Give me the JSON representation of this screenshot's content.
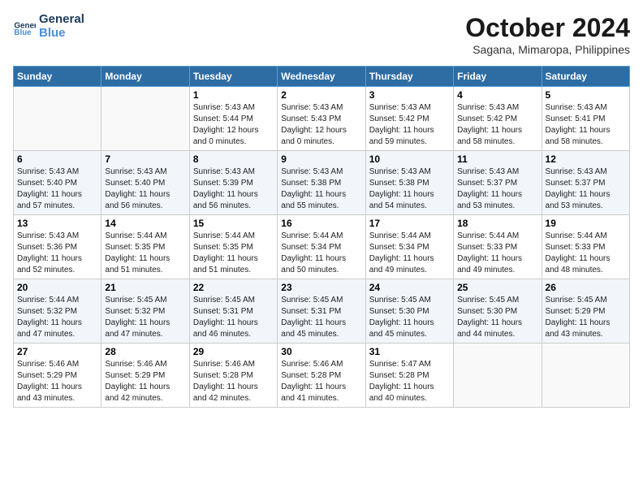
{
  "logo": {
    "line1": "General",
    "line2": "Blue"
  },
  "title": "October 2024",
  "subtitle": "Sagana, Mimaropa, Philippines",
  "weekdays": [
    "Sunday",
    "Monday",
    "Tuesday",
    "Wednesday",
    "Thursday",
    "Friday",
    "Saturday"
  ],
  "weeks": [
    [
      {
        "day": "",
        "info": ""
      },
      {
        "day": "",
        "info": ""
      },
      {
        "day": "1",
        "info": "Sunrise: 5:43 AM\nSunset: 5:44 PM\nDaylight: 12 hours\nand 0 minutes."
      },
      {
        "day": "2",
        "info": "Sunrise: 5:43 AM\nSunset: 5:43 PM\nDaylight: 12 hours\nand 0 minutes."
      },
      {
        "day": "3",
        "info": "Sunrise: 5:43 AM\nSunset: 5:42 PM\nDaylight: 11 hours\nand 59 minutes."
      },
      {
        "day": "4",
        "info": "Sunrise: 5:43 AM\nSunset: 5:42 PM\nDaylight: 11 hours\nand 58 minutes."
      },
      {
        "day": "5",
        "info": "Sunrise: 5:43 AM\nSunset: 5:41 PM\nDaylight: 11 hours\nand 58 minutes."
      }
    ],
    [
      {
        "day": "6",
        "info": "Sunrise: 5:43 AM\nSunset: 5:40 PM\nDaylight: 11 hours\nand 57 minutes."
      },
      {
        "day": "7",
        "info": "Sunrise: 5:43 AM\nSunset: 5:40 PM\nDaylight: 11 hours\nand 56 minutes."
      },
      {
        "day": "8",
        "info": "Sunrise: 5:43 AM\nSunset: 5:39 PM\nDaylight: 11 hours\nand 56 minutes."
      },
      {
        "day": "9",
        "info": "Sunrise: 5:43 AM\nSunset: 5:38 PM\nDaylight: 11 hours\nand 55 minutes."
      },
      {
        "day": "10",
        "info": "Sunrise: 5:43 AM\nSunset: 5:38 PM\nDaylight: 11 hours\nand 54 minutes."
      },
      {
        "day": "11",
        "info": "Sunrise: 5:43 AM\nSunset: 5:37 PM\nDaylight: 11 hours\nand 53 minutes."
      },
      {
        "day": "12",
        "info": "Sunrise: 5:43 AM\nSunset: 5:37 PM\nDaylight: 11 hours\nand 53 minutes."
      }
    ],
    [
      {
        "day": "13",
        "info": "Sunrise: 5:43 AM\nSunset: 5:36 PM\nDaylight: 11 hours\nand 52 minutes."
      },
      {
        "day": "14",
        "info": "Sunrise: 5:44 AM\nSunset: 5:35 PM\nDaylight: 11 hours\nand 51 minutes."
      },
      {
        "day": "15",
        "info": "Sunrise: 5:44 AM\nSunset: 5:35 PM\nDaylight: 11 hours\nand 51 minutes."
      },
      {
        "day": "16",
        "info": "Sunrise: 5:44 AM\nSunset: 5:34 PM\nDaylight: 11 hours\nand 50 minutes."
      },
      {
        "day": "17",
        "info": "Sunrise: 5:44 AM\nSunset: 5:34 PM\nDaylight: 11 hours\nand 49 minutes."
      },
      {
        "day": "18",
        "info": "Sunrise: 5:44 AM\nSunset: 5:33 PM\nDaylight: 11 hours\nand 49 minutes."
      },
      {
        "day": "19",
        "info": "Sunrise: 5:44 AM\nSunset: 5:33 PM\nDaylight: 11 hours\nand 48 minutes."
      }
    ],
    [
      {
        "day": "20",
        "info": "Sunrise: 5:44 AM\nSunset: 5:32 PM\nDaylight: 11 hours\nand 47 minutes."
      },
      {
        "day": "21",
        "info": "Sunrise: 5:45 AM\nSunset: 5:32 PM\nDaylight: 11 hours\nand 47 minutes."
      },
      {
        "day": "22",
        "info": "Sunrise: 5:45 AM\nSunset: 5:31 PM\nDaylight: 11 hours\nand 46 minutes."
      },
      {
        "day": "23",
        "info": "Sunrise: 5:45 AM\nSunset: 5:31 PM\nDaylight: 11 hours\nand 45 minutes."
      },
      {
        "day": "24",
        "info": "Sunrise: 5:45 AM\nSunset: 5:30 PM\nDaylight: 11 hours\nand 45 minutes."
      },
      {
        "day": "25",
        "info": "Sunrise: 5:45 AM\nSunset: 5:30 PM\nDaylight: 11 hours\nand 44 minutes."
      },
      {
        "day": "26",
        "info": "Sunrise: 5:45 AM\nSunset: 5:29 PM\nDaylight: 11 hours\nand 43 minutes."
      }
    ],
    [
      {
        "day": "27",
        "info": "Sunrise: 5:46 AM\nSunset: 5:29 PM\nDaylight: 11 hours\nand 43 minutes."
      },
      {
        "day": "28",
        "info": "Sunrise: 5:46 AM\nSunset: 5:29 PM\nDaylight: 11 hours\nand 42 minutes."
      },
      {
        "day": "29",
        "info": "Sunrise: 5:46 AM\nSunset: 5:28 PM\nDaylight: 11 hours\nand 42 minutes."
      },
      {
        "day": "30",
        "info": "Sunrise: 5:46 AM\nSunset: 5:28 PM\nDaylight: 11 hours\nand 41 minutes."
      },
      {
        "day": "31",
        "info": "Sunrise: 5:47 AM\nSunset: 5:28 PM\nDaylight: 11 hours\nand 40 minutes."
      },
      {
        "day": "",
        "info": ""
      },
      {
        "day": "",
        "info": ""
      }
    ]
  ]
}
